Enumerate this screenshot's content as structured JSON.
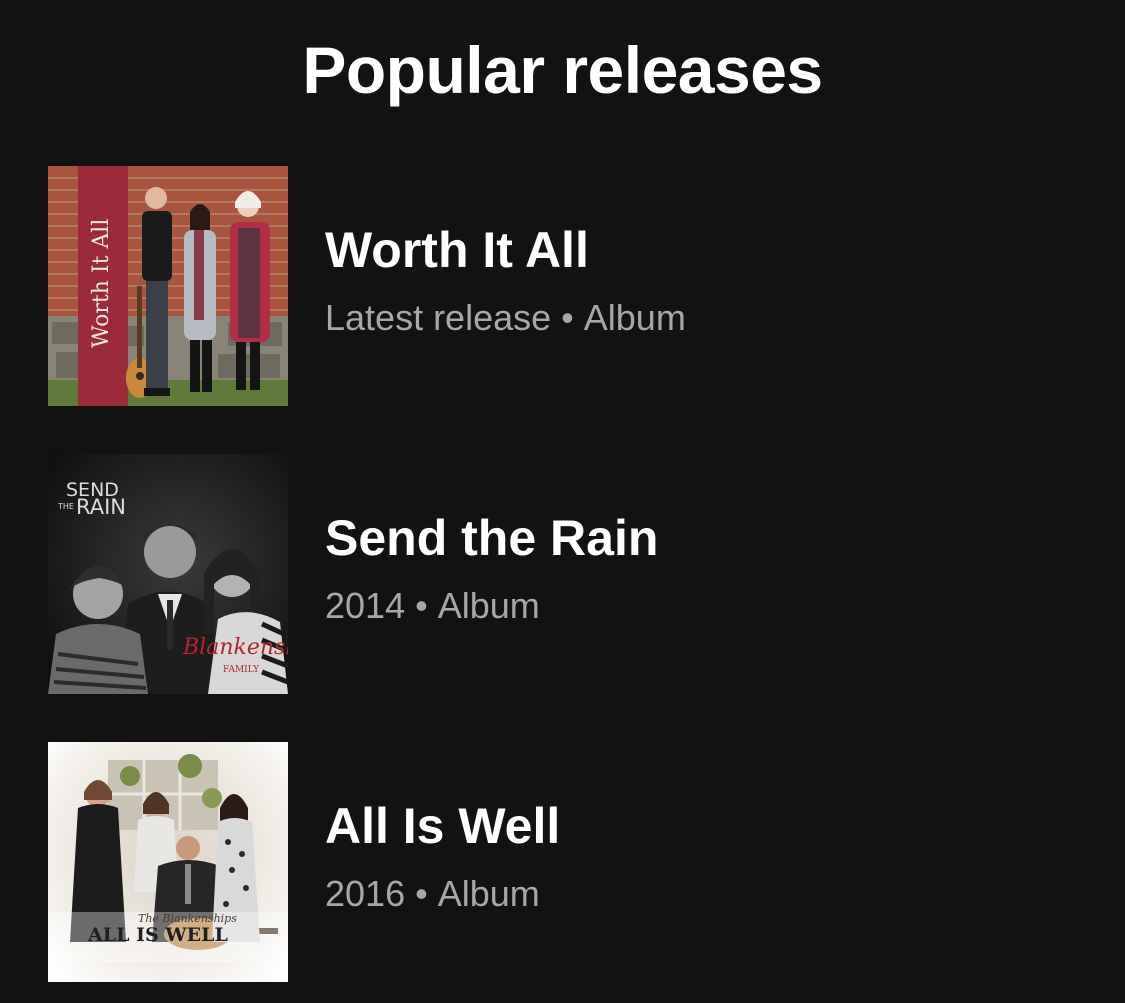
{
  "section": {
    "title": "Popular releases"
  },
  "releases": [
    {
      "title": "Worth It All",
      "meta_primary": "Latest release",
      "separator": "•",
      "meta_type": "Album",
      "cover_text": "Worth It All"
    },
    {
      "title": "Send the Rain",
      "meta_primary": "2014",
      "separator": "•",
      "meta_type": "Album",
      "cover_text_top": "SEND",
      "cover_text_small": "THE",
      "cover_text_main": "RAIN",
      "cover_script": "Blankenship",
      "cover_family": "FAMILY"
    },
    {
      "title": "All Is Well",
      "meta_primary": "2016",
      "separator": "•",
      "meta_type": "Album",
      "cover_script": "The Blankenships",
      "cover_text_main": "ALL IS WELL"
    }
  ],
  "colors": {
    "background": "#121212",
    "title_text": "#ffffff",
    "meta_text": "#a7a7a7",
    "cover1_banner": "#9b2b3b",
    "cover1_brick": "#a0513f"
  }
}
